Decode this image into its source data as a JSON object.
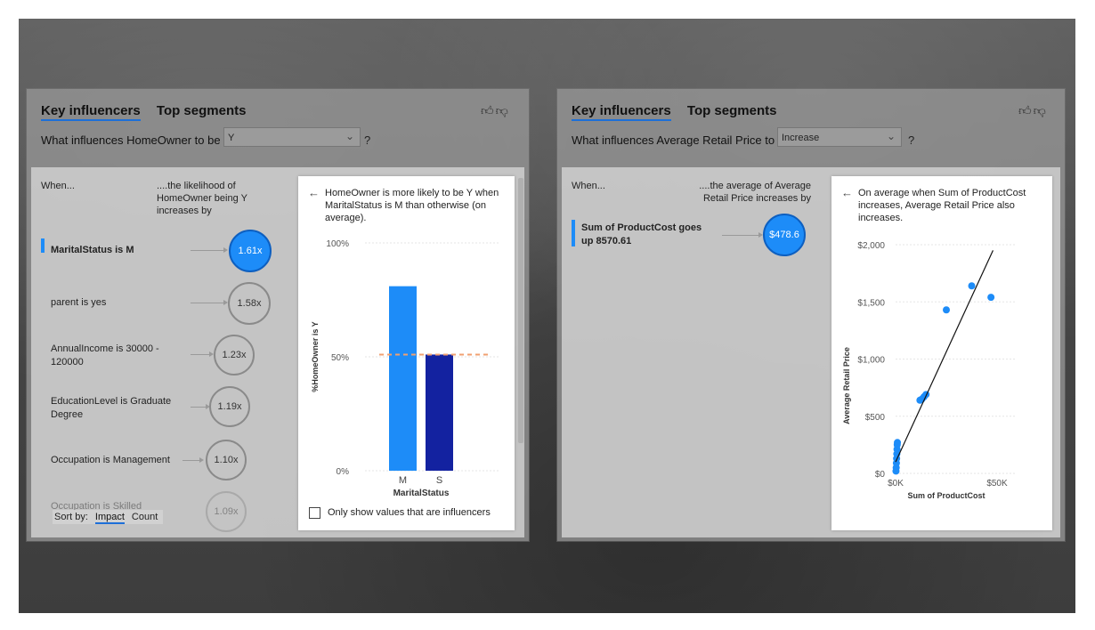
{
  "left": {
    "tabs": [
      "Key influencers",
      "Top segments"
    ],
    "question": "What influences HomeOwner to be",
    "select_value": "Y",
    "help": "?",
    "col_when": "When...",
    "col_effect": "....the likelihood of HomeOwner being Y increases by",
    "influencers": [
      {
        "label": "MaritalStatus is M",
        "value": "1.61x",
        "selected": true
      },
      {
        "label": "parent is yes",
        "value": "1.58x"
      },
      {
        "label": "AnnualIncome is 30000 - 120000",
        "value": "1.23x"
      },
      {
        "label": "EducationLevel is Graduate Degree",
        "value": "1.19x"
      },
      {
        "label": "Occupation is Management",
        "value": "1.10x"
      },
      {
        "label": "Occupation is Skilled",
        "value": "1.09x"
      }
    ],
    "sort_by": "Sort by:",
    "sort_options": [
      "Impact",
      "Count"
    ],
    "detail": {
      "description": "HomeOwner is more likely to be Y when MaritalStatus is M than otherwise (on average).",
      "checkbox_label": "Only show values that are influencers"
    }
  },
  "right": {
    "tabs": [
      "Key influencers",
      "Top segments"
    ],
    "question": "What influences Average Retail Price to",
    "select_value": "Increase",
    "help": "?",
    "col_when": "When...",
    "col_effect": "....the average of Average Retail Price increases by",
    "influencers": [
      {
        "label": "Sum of ProductCost goes up 8570.61",
        "value": "$478.6",
        "selected": true
      }
    ],
    "detail": {
      "description": "On average when Sum of ProductCost increases, Average Retail Price also increases."
    }
  },
  "colors": {
    "accent": "#1d8cf8",
    "accent_dark": "#1322a0",
    "dashed_line": "#f0a070"
  },
  "chart_data": [
    {
      "type": "bar",
      "categories": [
        "M",
        "S"
      ],
      "values": [
        81,
        51
      ],
      "average_line": 51,
      "xlabel": "MaritalStatus",
      "ylabel": "%HomeOwner is Y",
      "ylim": [
        0,
        100
      ],
      "yticks": [
        "0%",
        "50%",
        "100%"
      ]
    },
    {
      "type": "scatter",
      "xlabel": "Sum of ProductCost",
      "ylabel": "Average Retail Price",
      "xlim": [
        0,
        50000
      ],
      "ylim": [
        0,
        2000
      ],
      "xticks": [
        "$0K",
        "$50K"
      ],
      "yticks": [
        "$0",
        "$500",
        "$1,000",
        "$1,500",
        "$2,000"
      ],
      "points": [
        [
          200,
          20
        ],
        [
          300,
          50
        ],
        [
          400,
          90
        ],
        [
          500,
          130
        ],
        [
          600,
          170
        ],
        [
          700,
          210
        ],
        [
          800,
          250
        ],
        [
          900,
          270
        ],
        [
          12000,
          640
        ],
        [
          13000,
          650
        ],
        [
          14000,
          670
        ],
        [
          15000,
          690
        ],
        [
          25000,
          1430
        ],
        [
          37500,
          1640
        ],
        [
          47000,
          1540
        ]
      ],
      "trend": [
        [
          0,
          100
        ],
        [
          48000,
          1950
        ]
      ]
    }
  ]
}
